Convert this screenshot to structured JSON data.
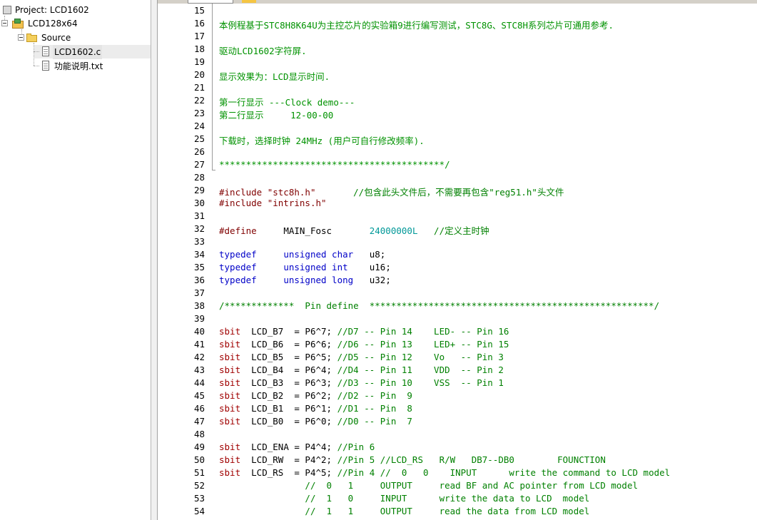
{
  "tree": {
    "project_label": "Project: LCD1602",
    "target_label": "LCD128x64",
    "group_label": "Source",
    "files": [
      "LCD1602.c",
      "功能说明.txt"
    ]
  },
  "editor": {
    "lines": [
      {
        "n": "15",
        "spans": []
      },
      {
        "n": "16",
        "spans": [
          {
            "c": "cm",
            "t": "本例程基于STC8H8K64U为主控芯片的实验箱9进行编写测试，STC8G、STC8H系列芯片可通用参考."
          }
        ]
      },
      {
        "n": "17",
        "spans": []
      },
      {
        "n": "18",
        "spans": [
          {
            "c": "cm",
            "t": "驱动LCD1602字符屏."
          }
        ]
      },
      {
        "n": "19",
        "spans": []
      },
      {
        "n": "20",
        "spans": [
          {
            "c": "cm",
            "t": "显示效果为：LCD显示时间."
          }
        ]
      },
      {
        "n": "21",
        "spans": []
      },
      {
        "n": "22",
        "spans": [
          {
            "c": "cm",
            "t": "第一行显示 ---Clock demo---"
          }
        ]
      },
      {
        "n": "23",
        "spans": [
          {
            "c": "cm",
            "t": "第二行显示     12-00-00"
          }
        ]
      },
      {
        "n": "24",
        "spans": []
      },
      {
        "n": "25",
        "spans": [
          {
            "c": "cm",
            "t": "下载时，选择时钟 24MHz (用户可自行修改频率)."
          }
        ]
      },
      {
        "n": "26",
        "spans": []
      },
      {
        "n": "27",
        "spans": [
          {
            "c": "cm",
            "t": "******************************************/"
          }
        ]
      },
      {
        "n": "28",
        "spans": []
      },
      {
        "n": "29",
        "spans": [
          {
            "c": "pp",
            "t": "#include "
          },
          {
            "c": "st",
            "t": "\"stc8h.h\""
          },
          {
            "c": "pl",
            "t": "       "
          },
          {
            "c": "cmt",
            "t": "//包含此头文件后，不需要再包含\"reg51.h\"头文件"
          }
        ]
      },
      {
        "n": "30",
        "spans": [
          {
            "c": "pp",
            "t": "#include "
          },
          {
            "c": "st",
            "t": "\"intrins.h\""
          }
        ]
      },
      {
        "n": "31",
        "spans": []
      },
      {
        "n": "32",
        "spans": [
          {
            "c": "pp",
            "t": "#define"
          },
          {
            "c": "pl",
            "t": "     MAIN_Fosc       "
          },
          {
            "c": "nm",
            "t": "24000000L"
          },
          {
            "c": "pl",
            "t": "   "
          },
          {
            "c": "cmt",
            "t": "//定义主时钟"
          }
        ]
      },
      {
        "n": "33",
        "spans": []
      },
      {
        "n": "34",
        "spans": [
          {
            "c": "kw",
            "t": "typedef"
          },
          {
            "c": "pl",
            "t": "     "
          },
          {
            "c": "kw",
            "t": "unsigned char"
          },
          {
            "c": "pl",
            "t": "   u8;"
          }
        ]
      },
      {
        "n": "35",
        "spans": [
          {
            "c": "kw",
            "t": "typedef"
          },
          {
            "c": "pl",
            "t": "     "
          },
          {
            "c": "kw",
            "t": "unsigned int"
          },
          {
            "c": "pl",
            "t": "    u16;"
          }
        ]
      },
      {
        "n": "36",
        "spans": [
          {
            "c": "kw",
            "t": "typedef"
          },
          {
            "c": "pl",
            "t": "     "
          },
          {
            "c": "kw",
            "t": "unsigned long"
          },
          {
            "c": "pl",
            "t": "   u32;"
          }
        ]
      },
      {
        "n": "37",
        "spans": []
      },
      {
        "n": "38",
        "spans": [
          {
            "c": "cmt",
            "t": "/*************  Pin define  *****************************************************/"
          }
        ]
      },
      {
        "n": "39",
        "spans": []
      },
      {
        "n": "40",
        "spans": [
          {
            "c": "sb",
            "t": "sbit"
          },
          {
            "c": "pl",
            "t": "  LCD_B7  = P6^7; "
          },
          {
            "c": "cmt",
            "t": "//D7 -- Pin 14    LED- -- Pin 16"
          }
        ]
      },
      {
        "n": "41",
        "spans": [
          {
            "c": "sb",
            "t": "sbit"
          },
          {
            "c": "pl",
            "t": "  LCD_B6  = P6^6; "
          },
          {
            "c": "cmt",
            "t": "//D6 -- Pin 13    LED+ -- Pin 15"
          }
        ]
      },
      {
        "n": "42",
        "spans": [
          {
            "c": "sb",
            "t": "sbit"
          },
          {
            "c": "pl",
            "t": "  LCD_B5  = P6^5; "
          },
          {
            "c": "cmt",
            "t": "//D5 -- Pin 12    Vo   -- Pin 3"
          }
        ]
      },
      {
        "n": "43",
        "spans": [
          {
            "c": "sb",
            "t": "sbit"
          },
          {
            "c": "pl",
            "t": "  LCD_B4  = P6^4; "
          },
          {
            "c": "cmt",
            "t": "//D4 -- Pin 11    VDD  -- Pin 2"
          }
        ]
      },
      {
        "n": "44",
        "spans": [
          {
            "c": "sb",
            "t": "sbit"
          },
          {
            "c": "pl",
            "t": "  LCD_B3  = P6^3; "
          },
          {
            "c": "cmt",
            "t": "//D3 -- Pin 10    VSS  -- Pin 1"
          }
        ]
      },
      {
        "n": "45",
        "spans": [
          {
            "c": "sb",
            "t": "sbit"
          },
          {
            "c": "pl",
            "t": "  LCD_B2  = P6^2; "
          },
          {
            "c": "cmt",
            "t": "//D2 -- Pin  9"
          }
        ]
      },
      {
        "n": "46",
        "spans": [
          {
            "c": "sb",
            "t": "sbit"
          },
          {
            "c": "pl",
            "t": "  LCD_B1  = P6^1; "
          },
          {
            "c": "cmt",
            "t": "//D1 -- Pin  8"
          }
        ]
      },
      {
        "n": "47",
        "spans": [
          {
            "c": "sb",
            "t": "sbit"
          },
          {
            "c": "pl",
            "t": "  LCD_B0  = P6^0; "
          },
          {
            "c": "cmt",
            "t": "//D0 -- Pin  7"
          }
        ]
      },
      {
        "n": "48",
        "spans": []
      },
      {
        "n": "49",
        "spans": [
          {
            "c": "sb",
            "t": "sbit"
          },
          {
            "c": "pl",
            "t": "  LCD_ENA = P4^4; "
          },
          {
            "c": "cmt",
            "t": "//Pin 6"
          }
        ]
      },
      {
        "n": "50",
        "spans": [
          {
            "c": "sb",
            "t": "sbit"
          },
          {
            "c": "pl",
            "t": "  LCD_RW  = P4^2; "
          },
          {
            "c": "cmt",
            "t": "//Pin 5 //LCD_RS   R/W   DB7--DB0        FOUNCTION"
          }
        ]
      },
      {
        "n": "51",
        "spans": [
          {
            "c": "sb",
            "t": "sbit"
          },
          {
            "c": "pl",
            "t": "  LCD_RS  = P4^5; "
          },
          {
            "c": "cmt",
            "t": "//Pin 4 //  0   0    INPUT      write the command to LCD model"
          }
        ]
      },
      {
        "n": "52",
        "spans": [
          {
            "c": "pl",
            "t": "                "
          },
          {
            "c": "cmt",
            "t": "//  0   1     OUTPUT     read BF and AC pointer from LCD model"
          }
        ]
      },
      {
        "n": "53",
        "spans": [
          {
            "c": "pl",
            "t": "                "
          },
          {
            "c": "cmt",
            "t": "//  1   0     INPUT      write the data to LCD  model"
          }
        ]
      },
      {
        "n": "54",
        "spans": [
          {
            "c": "pl",
            "t": "                "
          },
          {
            "c": "cmt",
            "t": "//  1   1     OUTPUT     read the data from LCD model"
          }
        ]
      }
    ]
  }
}
